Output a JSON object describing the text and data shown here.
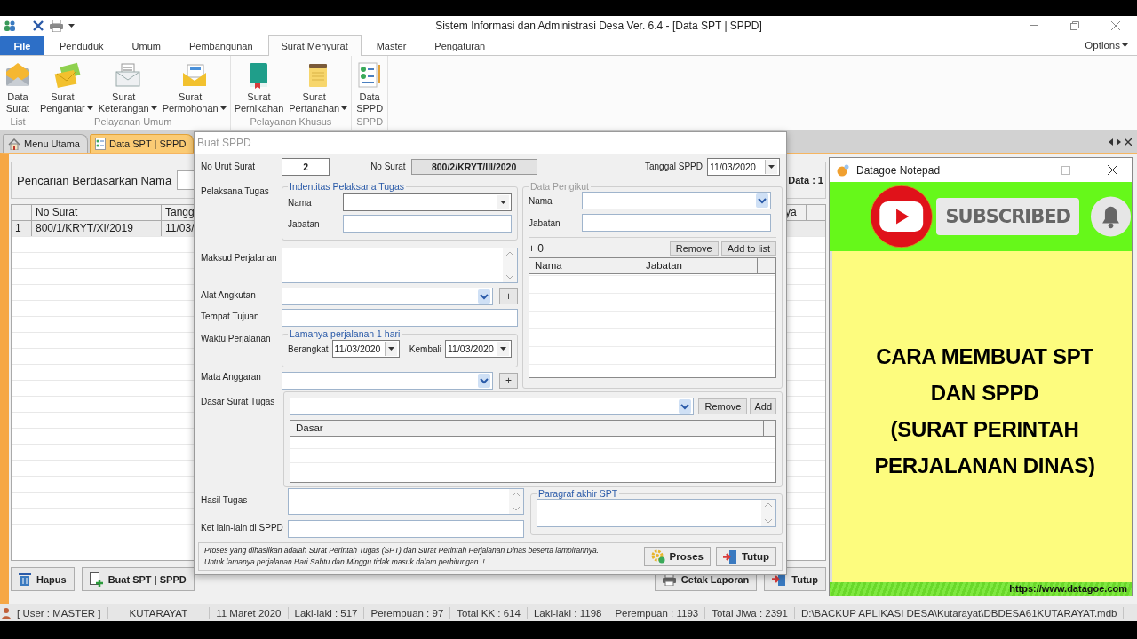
{
  "window": {
    "title": "Sistem Informasi dan Administrasi Desa Ver. 6.4 - [Data SPT | SPPD]"
  },
  "ribbon": {
    "tabs": [
      {
        "label": "File",
        "kind": "file",
        "selected": false
      },
      {
        "label": "Penduduk",
        "kind": "tab",
        "selected": false
      },
      {
        "label": "Umum",
        "kind": "tab",
        "selected": false
      },
      {
        "label": "Pembangunan",
        "kind": "tab",
        "selected": false
      },
      {
        "label": "Surat Menyurat",
        "kind": "tab",
        "selected": true
      },
      {
        "label": "Master",
        "kind": "tab",
        "selected": false
      },
      {
        "label": "Pengaturan",
        "kind": "tab",
        "selected": false
      }
    ],
    "options": "Options",
    "groups": [
      {
        "label": "List",
        "buttons": [
          {
            "label": "Data Surat",
            "dropdown": false
          }
        ]
      },
      {
        "label": "Pelayanan Umum",
        "buttons": [
          {
            "label": "Surat Pengantar",
            "dropdown": true
          },
          {
            "label": "Surat Keterangan",
            "dropdown": true
          },
          {
            "label": "Surat Permohonan",
            "dropdown": true
          }
        ]
      },
      {
        "label": "Pelayanan Khusus",
        "buttons": [
          {
            "label": "Surat Pernikahan",
            "dropdown": false
          },
          {
            "label": "Surat Pertanahan",
            "dropdown": true
          }
        ]
      },
      {
        "label": "SPPD",
        "buttons": [
          {
            "label": "Data SPPD",
            "dropdown": false
          }
        ]
      }
    ]
  },
  "doc_tabs": [
    {
      "label": "Menu Utama",
      "selected": false
    },
    {
      "label": "Data SPT | SPPD",
      "selected": true
    }
  ],
  "search": {
    "label": "Pencarian Berdasarkan Nama",
    "count": "Data : 1"
  },
  "table": {
    "columns": [
      "No Surat",
      "Tangg",
      "ya"
    ],
    "rows": [
      {
        "number": "1",
        "cells": [
          "800/1/KRYT/XI/2019",
          "11/03/"
        ]
      }
    ]
  },
  "actions_left": [
    "Hapus",
    "Buat SPT | SPPD"
  ],
  "actions_right": [
    "Cetak Laporan",
    "Tutup"
  ],
  "status_bar": [
    "[ User : MASTER ]",
    "KUTARAYAT",
    "11 Maret 2020",
    "Laki-laki : 517",
    "Perempuan : 97",
    "Total KK : 614",
    "Laki-laki : 1198",
    "Perempuan : 1193",
    "Total Jiwa : 2391",
    "D:\\BACKUP APLIKASI DESA\\Kutarayat\\DBDESA61KUTARAYAT.mdb"
  ],
  "dialog": {
    "title": "Buat SPPD",
    "no_urut_label": "No Urut Surat",
    "no_urut_value": "2",
    "no_surat_label": "No Surat",
    "no_surat_value": "800/2/KRYT/III/2020",
    "tanggal_label": "Tanggal SPPD",
    "tanggal_value": "11/03/2020",
    "pelaksana_label": "Pelaksana Tugas",
    "pelaksana_group": {
      "title": "Indentitas Pelaksana Tugas",
      "nama_label": "Nama",
      "jabatan_label": "Jabatan"
    },
    "maksud_label": "Maksud Perjalanan",
    "alat_label": "Alat Angkutan",
    "alat_add": "+",
    "tempat_label": "Tempat Tujuan",
    "waktu_label": "Waktu Perjalanan",
    "lama_group": {
      "title": "Lamanya perjalanan 1 hari",
      "berangkat_label": "Berangkat",
      "berangkat_value": "11/03/2020",
      "kembali_label": "Kembali",
      "kembali_value": "11/03/2020"
    },
    "mata_label": "Mata Anggaran",
    "mata_add": "+",
    "pengikut": {
      "title": "Data Pengikut",
      "disabled": true,
      "nama_label": "Nama",
      "jabatan_label": "Jabatan",
      "count": "+ 0",
      "remove": "Remove",
      "add": "Add to list",
      "columns": [
        "Nama",
        "Jabatan"
      ]
    },
    "dasar_label": "Dasar Surat Tugas",
    "dasar_remove": "Remove",
    "dasar_add": "Add",
    "dasar_columns": [
      "Dasar"
    ],
    "hasil_label": "Hasil Tugas",
    "ket_label": "Ket lain-lain di SPPD",
    "paragraf_title": "Paragraf akhir SPT",
    "notes": [
      "Proses yang dihasilkan adalah Surat Perintah Tugas (SPT) dan Surat Perintah Perjalanan Dinas beserta lampirannya.",
      "Untuk lamanya perjalanan Hari Sabtu dan Minggu tidak masuk dalam perhitungan..!"
    ],
    "proses": "Proses",
    "tutup": "Tutup"
  },
  "notepad": {
    "title": "Datagoe Notepad",
    "subscribe": "SUBSCRIBED",
    "text": "CARA MEMBUAT SPT\nDAN SPPD\n(SURAT PERINTAH\nPERJALANAN DINAS)",
    "footer": "https://www.datagoe.com"
  }
}
